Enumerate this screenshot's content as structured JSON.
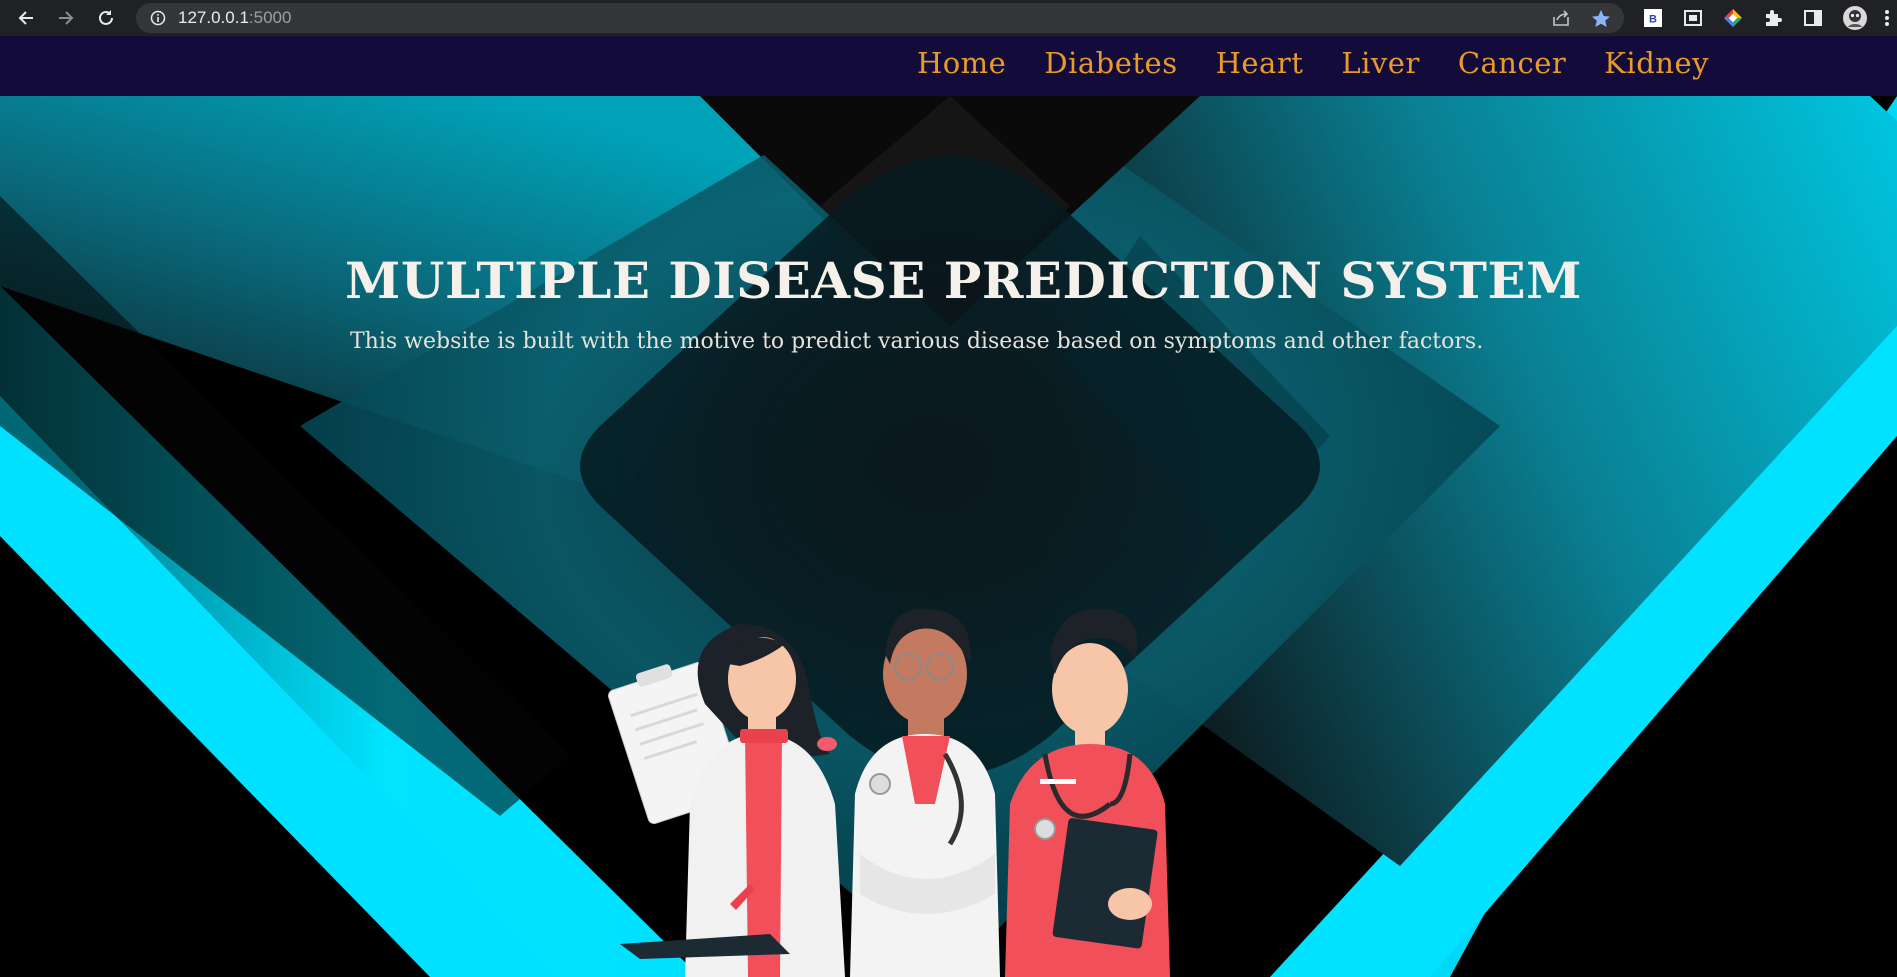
{
  "browser": {
    "url_host": "127.0.0.1",
    "url_port": ":5000",
    "icons": [
      "back-icon",
      "forward-icon",
      "reload-icon",
      "site-info-icon",
      "share-icon",
      "bookmark-star-icon",
      "extension-b-icon",
      "extension-window-icon",
      "extension-color-icon",
      "extensions-puzzle-icon",
      "side-panel-icon",
      "profile-avatar-icon",
      "menu-icon"
    ]
  },
  "nav": {
    "links": [
      "Home",
      "Diabetes",
      "Heart",
      "Liver",
      "Cancer",
      "Kidney"
    ],
    "link_color": "#e89a2a",
    "bg_color": "#130c3a"
  },
  "hero": {
    "title": "MULTIPLE DISEASE PREDICTION SYSTEM",
    "subtitle": "This website is built with the motive to predict various disease based on symptoms and other factors.",
    "accent_color": "#00e1ff",
    "illustration": "three-doctors-illustration"
  }
}
